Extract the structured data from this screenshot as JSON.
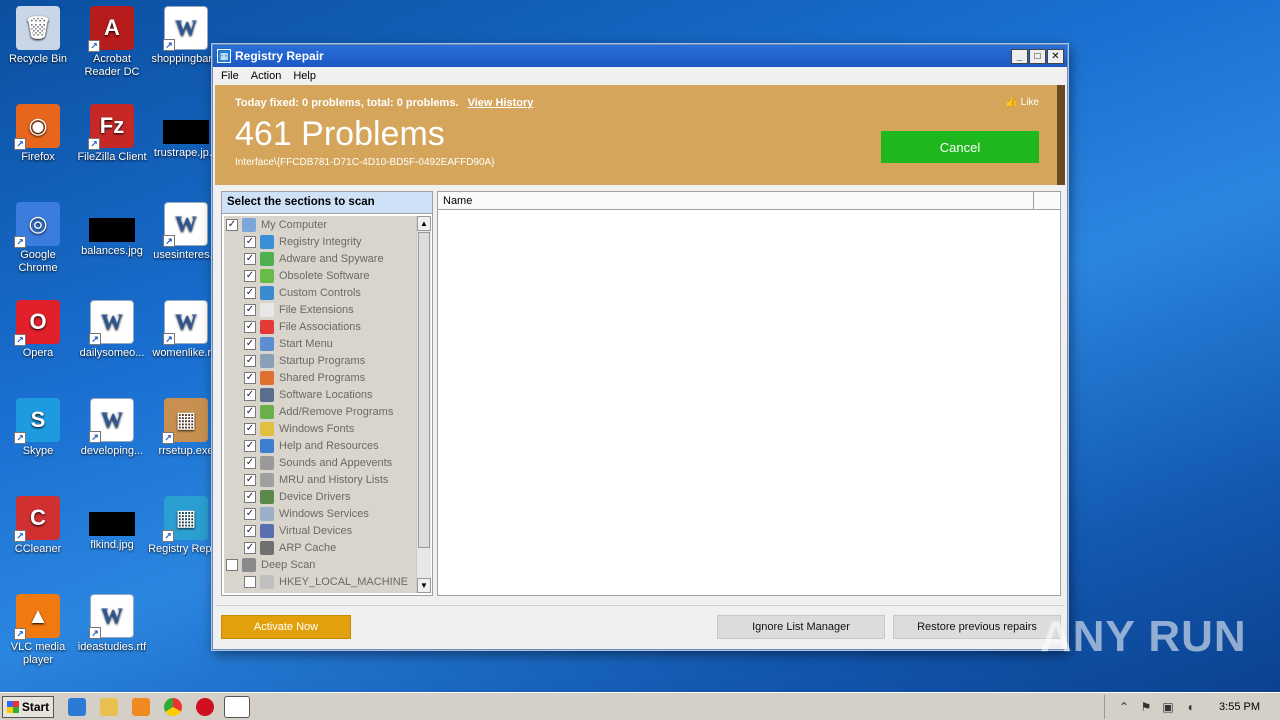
{
  "desktop": {
    "icons": [
      {
        "label": "Recycle Bin"
      },
      {
        "label": "Acrobat Reader DC"
      },
      {
        "label": "shoppingbar..."
      },
      {
        "label": "Firefox"
      },
      {
        "label": "FileZilla Client"
      },
      {
        "label": "trustrape.jp..."
      },
      {
        "label": "Google Chrome"
      },
      {
        "label": "balances.jpg"
      },
      {
        "label": "usesinteres..."
      },
      {
        "label": "Opera"
      },
      {
        "label": "dailysomeo..."
      },
      {
        "label": "womenlike.r..."
      },
      {
        "label": "Skype"
      },
      {
        "label": "developing..."
      },
      {
        "label": "rrsetup.exe"
      },
      {
        "label": "CCleaner"
      },
      {
        "label": "flkind.jpg"
      },
      {
        "label": "Registry Repair"
      },
      {
        "label": "VLC media player"
      },
      {
        "label": "ideastudies.rtf"
      }
    ]
  },
  "window": {
    "title": "Registry Repair",
    "menu": [
      "File",
      "Action",
      "Help"
    ],
    "banner": {
      "fixed_text": "Today fixed: 0 problems, total: 0 problems.",
      "view_history": "View History",
      "problems": "461 Problems",
      "interface": "Interface\\{FFCDB781-D71C-4D10-BD5F-0492EAFFD90A}",
      "like": "Like",
      "cancel": "Cancel"
    },
    "sections": {
      "header": "Select the sections to scan",
      "items": [
        {
          "label": "My Computer",
          "checked": true,
          "level": 0,
          "color": "#7aa6d8"
        },
        {
          "label": "Registry Integrity",
          "checked": true,
          "level": 1,
          "color": "#3b8fd9"
        },
        {
          "label": "Adware and Spyware",
          "checked": true,
          "level": 1,
          "color": "#4caf50"
        },
        {
          "label": "Obsolete Software",
          "checked": true,
          "level": 1,
          "color": "#6aba4a"
        },
        {
          "label": "Custom Controls",
          "checked": true,
          "level": 1,
          "color": "#3c8ad0"
        },
        {
          "label": "File Extensions",
          "checked": true,
          "level": 1,
          "color": "#e8e8e8"
        },
        {
          "label": "File Associations",
          "checked": true,
          "level": 1,
          "color": "#e53935"
        },
        {
          "label": "Start Menu",
          "checked": true,
          "level": 1,
          "color": "#5a8fd0"
        },
        {
          "label": "Startup Programs",
          "checked": true,
          "level": 1,
          "color": "#8aa0b8"
        },
        {
          "label": "Shared Programs",
          "checked": true,
          "level": 1,
          "color": "#e07030"
        },
        {
          "label": "Software Locations",
          "checked": true,
          "level": 1,
          "color": "#5a6f8f"
        },
        {
          "label": "Add/Remove Programs",
          "checked": true,
          "level": 1,
          "color": "#6ab04c"
        },
        {
          "label": "Windows Fonts",
          "checked": true,
          "level": 1,
          "color": "#e0c040"
        },
        {
          "label": "Help and Resources",
          "checked": true,
          "level": 1,
          "color": "#3a7fd0"
        },
        {
          "label": "Sounds and Appevents",
          "checked": true,
          "level": 1,
          "color": "#9a9a9a"
        },
        {
          "label": "MRU and History Lists",
          "checked": true,
          "level": 1,
          "color": "#a0a0a0"
        },
        {
          "label": "Device Drivers",
          "checked": true,
          "level": 1,
          "color": "#5a8a4a"
        },
        {
          "label": "Windows Services",
          "checked": true,
          "level": 1,
          "color": "#9ab0c8"
        },
        {
          "label": "Virtual Devices",
          "checked": true,
          "level": 1,
          "color": "#5a6fb0"
        },
        {
          "label": "ARP Cache",
          "checked": true,
          "level": 1,
          "color": "#707070"
        },
        {
          "label": "Deep Scan",
          "checked": false,
          "level": 0,
          "color": "#8a8a8a"
        },
        {
          "label": "HKEY_LOCAL_MACHINE",
          "checked": false,
          "level": 1,
          "color": "#c0c0c0"
        }
      ]
    },
    "list": {
      "column": "Name"
    },
    "buttons": {
      "activate": "Activate Now",
      "ignore": "Ignore List Manager",
      "restore": "Restore previous repairs"
    }
  },
  "taskbar": {
    "start": "Start",
    "clock": "3:55 PM"
  },
  "watermark": "ANY RUN"
}
